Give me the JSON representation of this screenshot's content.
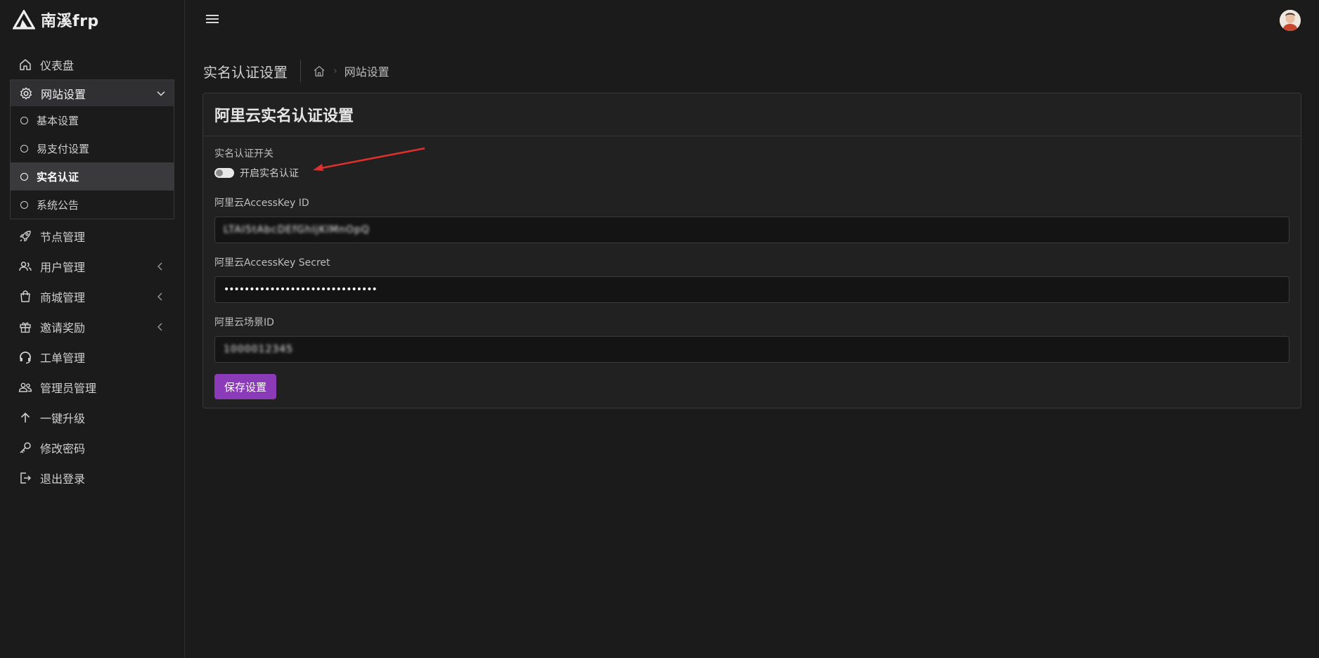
{
  "brand": {
    "name": "南溪frp",
    "logo_icon": "triangle-logo-icon"
  },
  "sidebar": {
    "items": [
      {
        "label": "仪表盘",
        "icon": "home-icon"
      },
      {
        "label": "网站设置",
        "icon": "gear-icon",
        "expanded": true
      },
      {
        "label": "节点管理",
        "icon": "rocket-icon"
      },
      {
        "label": "用户管理",
        "icon": "users-icon"
      },
      {
        "label": "商城管理",
        "icon": "bag-icon"
      },
      {
        "label": "邀请奖励",
        "icon": "gift-icon"
      },
      {
        "label": "工单管理",
        "icon": "headset-icon"
      },
      {
        "label": "管理员管理",
        "icon": "admins-icon"
      },
      {
        "label": "一键升级",
        "icon": "arrow-up-icon"
      },
      {
        "label": "修改密码",
        "icon": "key-icon"
      },
      {
        "label": "退出登录",
        "icon": "logout-icon"
      }
    ],
    "submenu": [
      {
        "label": "基本设置"
      },
      {
        "label": "易支付设置"
      },
      {
        "label": "实名认证",
        "active": true
      },
      {
        "label": "系统公告"
      }
    ]
  },
  "header": {
    "page_title": "实名认证设置",
    "breadcrumb": {
      "current": "网站设置"
    }
  },
  "card": {
    "title": "阿里云实名认证设置",
    "switch_section_label": "实名认证开关",
    "switch_label": "开启实名认证",
    "switch_on": false,
    "fields": [
      {
        "label": "阿里云AccessKey ID",
        "value": "LTAI5tAbcDEfGhIjKlMnOpQ"
      },
      {
        "label": "阿里云AccessKey Secret",
        "value": "••••••••••••••••••••••••••••••"
      },
      {
        "label": "阿里云场景ID",
        "value": "1000012345"
      }
    ],
    "save_label": "保存设置"
  },
  "colors": {
    "accent": "#8b3ab8",
    "annotation_arrow": "#e0302e",
    "background": "#1b1b1c"
  }
}
